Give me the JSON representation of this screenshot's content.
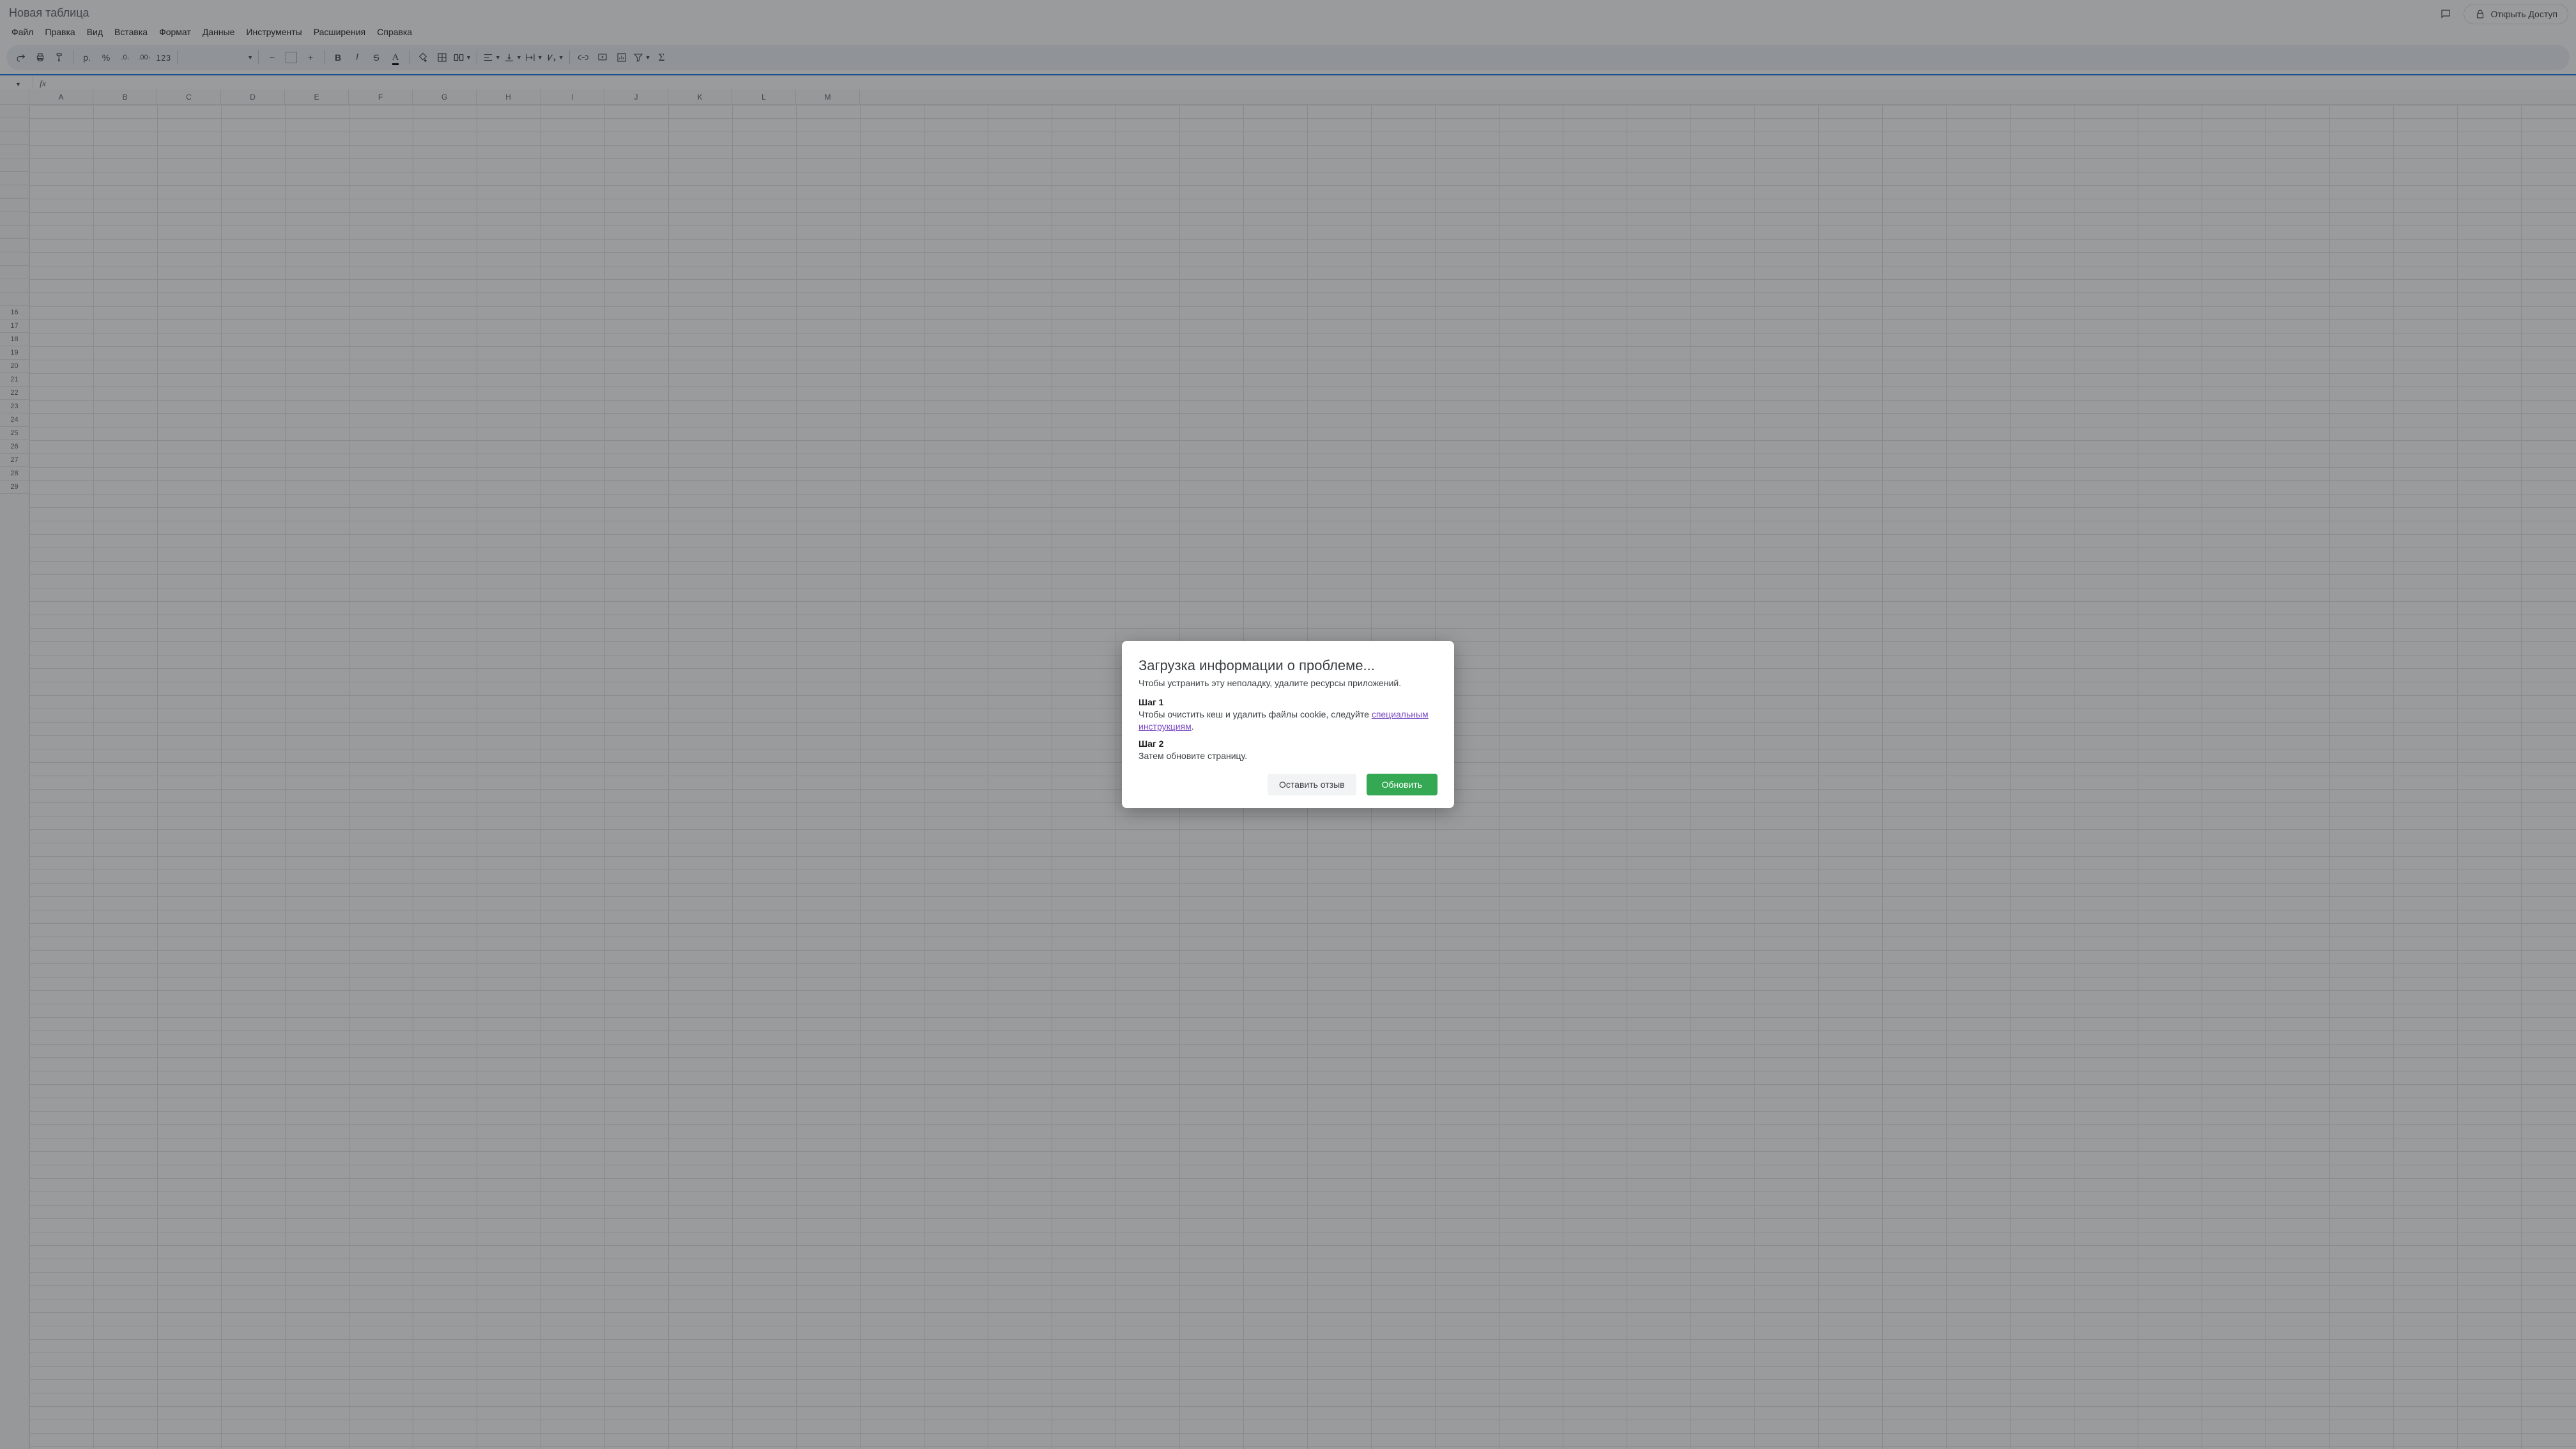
{
  "doc": {
    "title": "Новая таблица"
  },
  "menus": [
    "Файл",
    "Правка",
    "Вид",
    "Вставка",
    "Формат",
    "Данные",
    "Инструменты",
    "Расширения",
    "Справка"
  ],
  "share": {
    "label": "Открыть Доступ"
  },
  "toolbar": {
    "currency": "р.",
    "percent": "%",
    "dec_dec": ".0",
    "dec_inc": ".00",
    "num_fmt": "123",
    "font": "",
    "minus": "−",
    "plus": "+",
    "bold": "B",
    "italic": "I",
    "strike": "S",
    "textcolor": "A"
  },
  "formula": {
    "cell_ref": "",
    "fx_label": "fx",
    "value": ""
  },
  "columns": [
    "A",
    "B",
    "C",
    "D",
    "E",
    "F",
    "G",
    "H",
    "I",
    "J",
    "K",
    "L",
    "M"
  ],
  "rows": [
    "",
    "",
    "",
    "",
    "",
    "",
    "",
    "",
    "",
    "",
    "",
    "",
    "",
    "",
    "",
    "16",
    "17",
    "18",
    "19",
    "20",
    "21",
    "22",
    "23",
    "24",
    "25",
    "26",
    "27",
    "28",
    "29"
  ],
  "dialog": {
    "title": "Загрузка информации о проблеме...",
    "subtitle": "Чтобы устранить эту неполадку, удалите ресурсы приложений.",
    "step1_h": "Шаг 1",
    "step1_pre": "Чтобы очистить кеш и удалить файлы cookie, следуйте ",
    "step1_link": "специальным инструкциям",
    "step1_post": ".",
    "step2_h": "Шаг 2",
    "step2_p": "Затем обновите страницу.",
    "feedback_btn": "Оставить отзыв",
    "refresh_btn": "Обновить"
  }
}
